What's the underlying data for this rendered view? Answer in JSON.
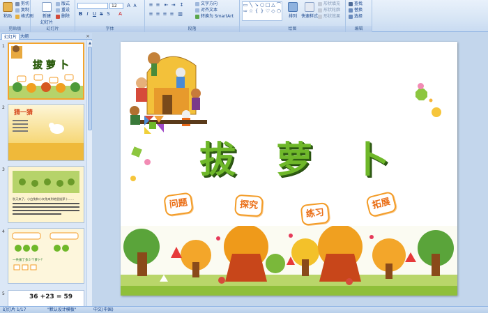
{
  "ribbon": {
    "clipboard": {
      "paste": "粘贴",
      "cut": "剪切",
      "copy": "复制",
      "format_painter": "格式刷",
      "label": "剪贴板"
    },
    "slides": {
      "new_slide": "新建\n幻灯片",
      "layout": "版式",
      "reset": "重设",
      "delete": "删除",
      "label": "幻灯片"
    },
    "font": {
      "name": "",
      "size": "12",
      "label": "字体"
    },
    "paragraph": {
      "text_direction": "文字方向",
      "align_text": "对齐文本",
      "smartart": "转换为 SmartArt",
      "label": "段落"
    },
    "drawing": {
      "arrange": "排列",
      "quick_styles": "快速样式",
      "shape_fill": "形状填充",
      "shape_outline": "形状轮廓",
      "shape_effects": "形状效果",
      "label": "绘图"
    },
    "editing": {
      "find": "查找",
      "replace": "替换",
      "select": "选择",
      "label": "编辑"
    }
  },
  "pane": {
    "tab_slides": "幻灯片",
    "tab_outline": "大纲",
    "close": "×",
    "thumbs": [
      {
        "num": "1"
      },
      {
        "num": "2",
        "title": "猜一猜"
      },
      {
        "num": "3",
        "text": "秋天来了，小白兔和小灰兔来到地里拔萝卜……"
      },
      {
        "num": "4",
        "text": "一共拔了多少个萝卜？"
      },
      {
        "num": "5",
        "equation": "36 +23 = 59"
      }
    ]
  },
  "slide": {
    "title_chars": [
      "拔",
      "萝",
      "卜"
    ],
    "badges": [
      "问题",
      "探究",
      "练习",
      "拓展"
    ]
  },
  "status": {
    "slide_info": "幻灯片 1/17",
    "theme": "\"默认设计模板\"",
    "language": "中文(中国)"
  },
  "colors": {
    "title_green": "#6fb82a",
    "badge_orange": "#f39c28",
    "ribbon_blue": "#15428b"
  }
}
